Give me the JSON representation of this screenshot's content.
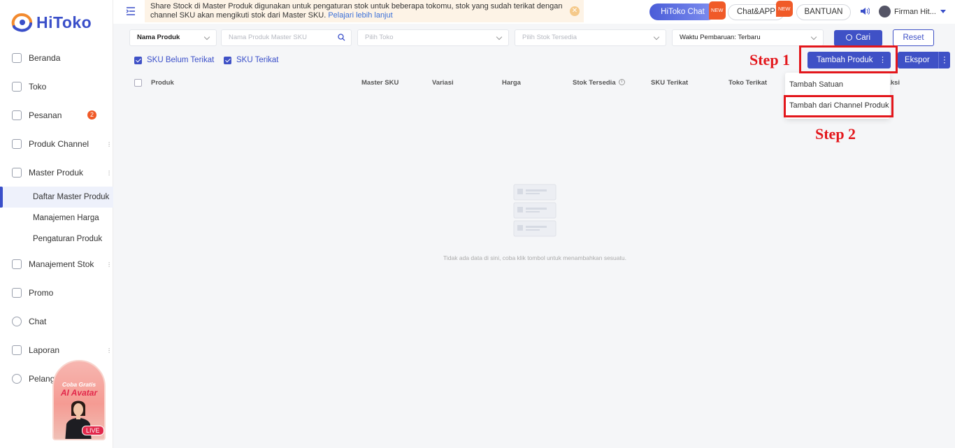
{
  "app": {
    "logo_text": "HiToko"
  },
  "sidebar": {
    "items": [
      {
        "label": "Beranda",
        "icon": "monitor-icon"
      },
      {
        "label": "Toko",
        "icon": "store-icon"
      },
      {
        "label": "Pesanan",
        "icon": "order-icon",
        "badge": "2"
      },
      {
        "label": "Produk Channel",
        "icon": "grid-icon"
      },
      {
        "label": "Master Produk",
        "icon": "cube-icon"
      },
      {
        "label": "Manajement Stok",
        "icon": "stock-icon"
      },
      {
        "label": "Promo",
        "icon": "promo-icon"
      },
      {
        "label": "Chat",
        "icon": "chat-icon"
      },
      {
        "label": "Laporan",
        "icon": "report-icon"
      },
      {
        "label": "Pelanggan",
        "icon": "customers-icon"
      }
    ],
    "sub_items": [
      "Daftar Master Produk",
      "Manajemen Harga",
      "Pengaturan Produk"
    ],
    "promo": {
      "line1": "Coba Gratis",
      "line2": "AI Avatar",
      "live": "LIVE"
    }
  },
  "topbar": {
    "notice_text": "Share Stock di Master Produk digunakan untuk pengaturan stok untuk beberapa tokomu, stok yang sudah terikat dengan channel SKU akan mengikuti stok dari Master SKU.",
    "notice_link": "Pelajari lebih lanjut",
    "hitoko_chat": "HiToko Chat",
    "chat_app": "Chat&APP",
    "new_tag": "NEW",
    "help": "BANTUAN",
    "user_name": "Firman Hit..."
  },
  "filters": {
    "field_type": "Nama Produk",
    "search_placeholder": "Nama Produk Master SKU",
    "store": "Pilih Toko",
    "stock": "Pilih Stok Tersedia",
    "sort": "Waktu Pembaruan: Terbaru",
    "search_button": "Cari",
    "reset_button": "Reset"
  },
  "checks": {
    "unbound": "SKU Belum Terikat",
    "bound": "SKU Terikat"
  },
  "actions": {
    "add_product": "Tambah Produk",
    "export": "Ekspor"
  },
  "dropdown": {
    "item1": "Tambah Satuan",
    "item2": "Tambah dari Channel Produk"
  },
  "annotations": {
    "step1": "Step 1",
    "step2": "Step 2"
  },
  "table": {
    "headers": [
      "Produk",
      "Master SKU",
      "Variasi",
      "Harga",
      "Stok Tersedia",
      "SKU Terikat",
      "Toko Terikat",
      "Aksi"
    ],
    "empty_text": "Tidak ada data di sini, coba klik tombol untuk menambahkan sesuatu."
  },
  "colors": {
    "accent": "#3f51c6",
    "annotation": "#e3171c",
    "notice_bg": "#fdf3e6"
  }
}
